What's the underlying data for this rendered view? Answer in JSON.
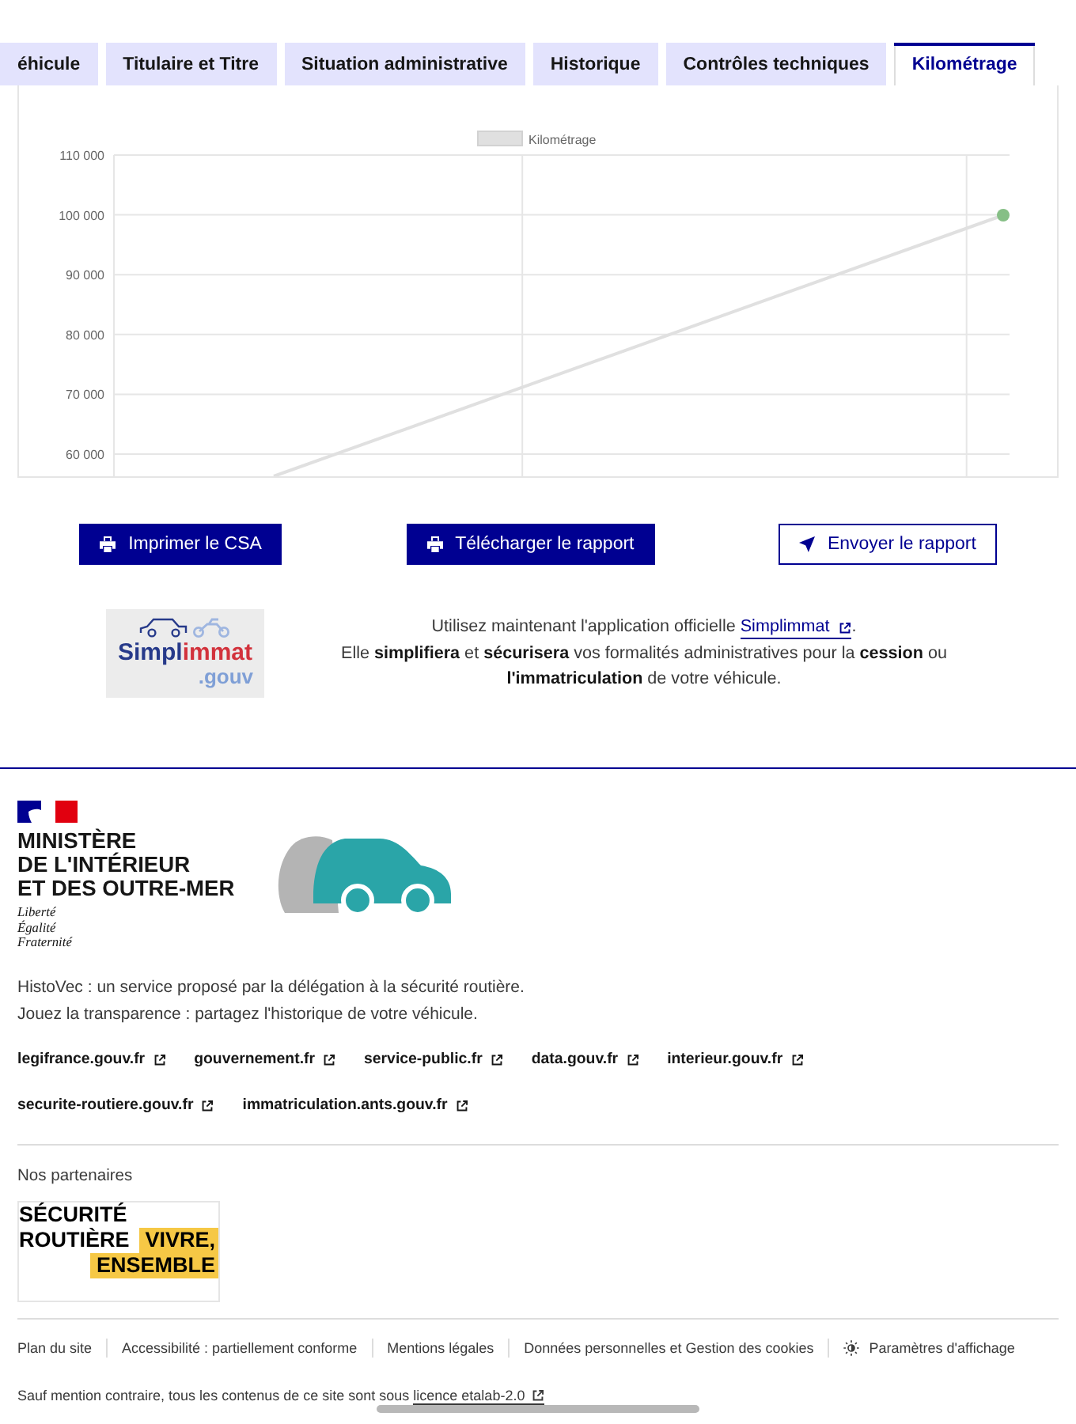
{
  "tabs": [
    {
      "label": "éhicule",
      "selected": false
    },
    {
      "label": "Titulaire et Titre",
      "selected": false
    },
    {
      "label": "Situation administrative",
      "selected": false
    },
    {
      "label": "Historique",
      "selected": false
    },
    {
      "label": "Contrôles techniques",
      "selected": false
    },
    {
      "label": "Kilométrage",
      "selected": true
    }
  ],
  "mileage_panel": {
    "legend_label": "Kilométrage",
    "y_axis_labels": [
      "110 000",
      "100 000",
      "90 000",
      "80 000",
      "70 000",
      "60 000"
    ]
  },
  "actions": [
    {
      "label": "Imprimer le CSA",
      "kind": "primary"
    },
    {
      "label": "Télécharger le rapport",
      "kind": "primary"
    },
    {
      "label": "Envoyer le rapport",
      "kind": "secondary"
    }
  ],
  "simplimmat": {
    "logo": {
      "name_parts": [
        "Simpl",
        "immat"
      ],
      "domain": ".gouv"
    },
    "intro": "Utilisez maintenant l'application officielle",
    "link": "Simplimmat",
    "intro_end": ".",
    "body": "Elle **simplifiera** et **sécurisera** vos formalités administratives pour la **cession** ou **l'immatriculation** de votre véhicule."
  },
  "footer": {
    "ministry": [
      "MINISTÈRE",
      "DE L'INTÉRIEUR",
      "ET DES OUTRE-MER"
    ],
    "motto": [
      "Liberté",
      "Égalité",
      "Fraternité"
    ],
    "description": [
      "HistoVec : un service proposé par la délégation à la sécurité routière.",
      "Jouez la transparence : partagez l'historique de votre véhicule."
    ],
    "links": [
      "legifrance.gouv.fr",
      "gouvernement.fr",
      "service-public.fr",
      "data.gouv.fr",
      "interieur.gouv.fr",
      "securite-routiere.gouv.fr",
      "immatriculation.ants.gouv.fr"
    ],
    "partners": {
      "title": "Nos partenaires",
      "logo": {
        "name_lines": [
          "SÉCURITÉ",
          "ROUTIÈRE"
        ],
        "slogan_lines": [
          "VIVRE,",
          "ENSEMBLE"
        ]
      }
    },
    "bottom_links": [
      {
        "label": "Plan du site",
        "kind": "link"
      },
      {
        "label": "Accessibilité : partiellement conforme",
        "kind": "link"
      },
      {
        "label": "Mentions légales",
        "kind": "link"
      },
      {
        "label": "Données personnelles et Gestion des cookies",
        "kind": "link"
      },
      {
        "label": "Paramètres d'affichage",
        "kind": "settings"
      }
    ],
    "license": {
      "text": "Sauf mention contraire, tous les contenus de ce site sont sous",
      "link": "licence etalab-2.0"
    }
  }
}
